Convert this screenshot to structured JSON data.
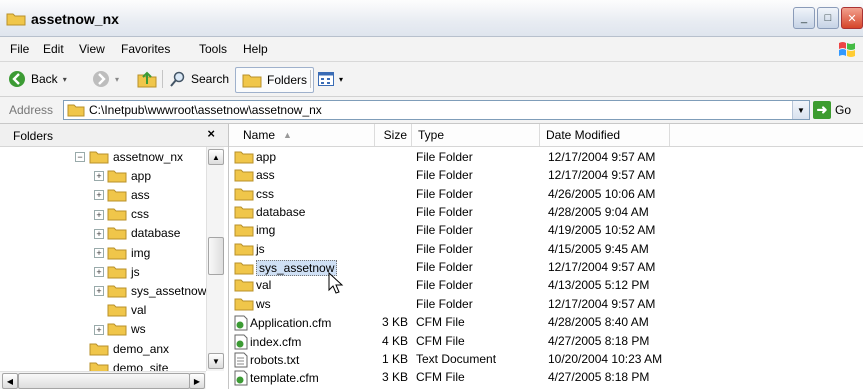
{
  "window": {
    "title": "assetnow_nx",
    "min_glyph": "_",
    "max_glyph": "□",
    "close_glyph": "✕"
  },
  "menu": [
    "File",
    "Edit",
    "View",
    "Favorites",
    "Tools",
    "Help"
  ],
  "toolbar": {
    "back": "Back",
    "search": "Search",
    "folders": "Folders"
  },
  "address": {
    "label": "Address",
    "path": "C:\\Inetpub\\wwwroot\\assetnow\\assetnow_nx",
    "go": "Go"
  },
  "folders_pane": {
    "title": "Folders",
    "close_glyph": "×",
    "tree": [
      {
        "label": "assetnow_nx",
        "depth": 0,
        "expander": "⊟",
        "open": true
      },
      {
        "label": "app",
        "depth": 1,
        "expander": "⊞"
      },
      {
        "label": "ass",
        "depth": 1,
        "expander": "⊞"
      },
      {
        "label": "css",
        "depth": 1,
        "expander": "⊞"
      },
      {
        "label": "database",
        "depth": 1,
        "expander": "⊞"
      },
      {
        "label": "img",
        "depth": 1,
        "expander": "⊞"
      },
      {
        "label": "js",
        "depth": 1,
        "expander": "⊞"
      },
      {
        "label": "sys_assetnow",
        "depth": 1,
        "expander": "⊞"
      },
      {
        "label": "val",
        "depth": 1,
        "expander": ""
      },
      {
        "label": "ws",
        "depth": 1,
        "expander": "⊞"
      },
      {
        "label": "demo_anx",
        "depth": 0,
        "expander": ""
      },
      {
        "label": "demo_site",
        "depth": 0,
        "expander": ""
      }
    ]
  },
  "files": {
    "columns": {
      "name": "Name",
      "size": "Size",
      "type": "Type",
      "modified": "Date Modified"
    },
    "rows": [
      {
        "name": "app",
        "size": "",
        "type": "File Folder",
        "modified": "12/17/2004 9:57 AM",
        "icon": "folder-icon"
      },
      {
        "name": "ass",
        "size": "",
        "type": "File Folder",
        "modified": "12/17/2004 9:57 AM",
        "icon": "folder-icon"
      },
      {
        "name": "css",
        "size": "",
        "type": "File Folder",
        "modified": "4/26/2005 10:06 AM",
        "icon": "folder-icon"
      },
      {
        "name": "database",
        "size": "",
        "type": "File Folder",
        "modified": "4/28/2005 9:04 AM",
        "icon": "folder-icon"
      },
      {
        "name": "img",
        "size": "",
        "type": "File Folder",
        "modified": "4/19/2005 10:52 AM",
        "icon": "folder-icon"
      },
      {
        "name": "js",
        "size": "",
        "type": "File Folder",
        "modified": "4/15/2005 9:45 AM",
        "icon": "folder-icon"
      },
      {
        "name": "sys_assetnow",
        "size": "",
        "type": "File Folder",
        "modified": "12/17/2004 9:57 AM",
        "icon": "folder-icon",
        "selected": true
      },
      {
        "name": "val",
        "size": "",
        "type": "File Folder",
        "modified": "4/13/2005 5:12 PM",
        "icon": "folder-icon"
      },
      {
        "name": "ws",
        "size": "",
        "type": "File Folder",
        "modified": "12/17/2004 9:57 AM",
        "icon": "folder-icon"
      },
      {
        "name": "Application.cfm",
        "size": "3 KB",
        "type": "CFM File",
        "modified": "4/28/2005 8:40 AM",
        "icon": "cfm-file-icon"
      },
      {
        "name": "index.cfm",
        "size": "4 KB",
        "type": "CFM File",
        "modified": "4/27/2005 8:18 PM",
        "icon": "cfm-file-icon"
      },
      {
        "name": "robots.txt",
        "size": "1 KB",
        "type": "Text Document",
        "modified": "10/20/2004 10:23 AM",
        "icon": "text-file-icon"
      },
      {
        "name": "template.cfm",
        "size": "3 KB",
        "type": "CFM File",
        "modified": "4/27/2005 8:18 PM",
        "icon": "cfm-file-icon"
      }
    ]
  },
  "colors": {
    "folder": "#f0c64a",
    "selection": "#cfe0f5",
    "go_green": "#3d9c2f"
  }
}
